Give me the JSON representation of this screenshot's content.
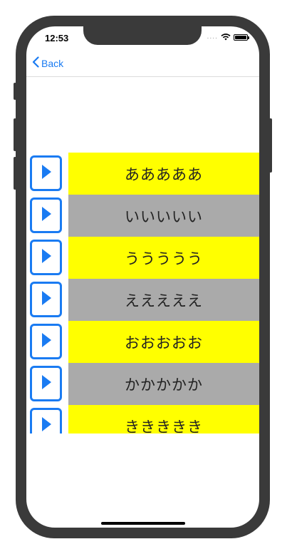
{
  "status_bar": {
    "time": "12:53",
    "signal": "....",
    "wifi_icon": "wifi-icon",
    "battery_icon": "battery-icon"
  },
  "navbar": {
    "back_label": "Back",
    "back_icon": "chevron-left-icon"
  },
  "colors": {
    "accent": "#1a7bf2",
    "yellow_row": "#ffff00",
    "gray_row": "#aaaaaa"
  },
  "list": {
    "items": [
      {
        "label": "あああああ",
        "color": "#ffff00"
      },
      {
        "label": "いいいいい",
        "color": "#aaaaaa"
      },
      {
        "label": "ううううう",
        "color": "#ffff00"
      },
      {
        "label": "えええええ",
        "color": "#aaaaaa"
      },
      {
        "label": "おおおおお",
        "color": "#ffff00"
      },
      {
        "label": "かかかかか",
        "color": "#aaaaaa"
      },
      {
        "label": "ききききき",
        "color": "#ffff00"
      }
    ]
  }
}
